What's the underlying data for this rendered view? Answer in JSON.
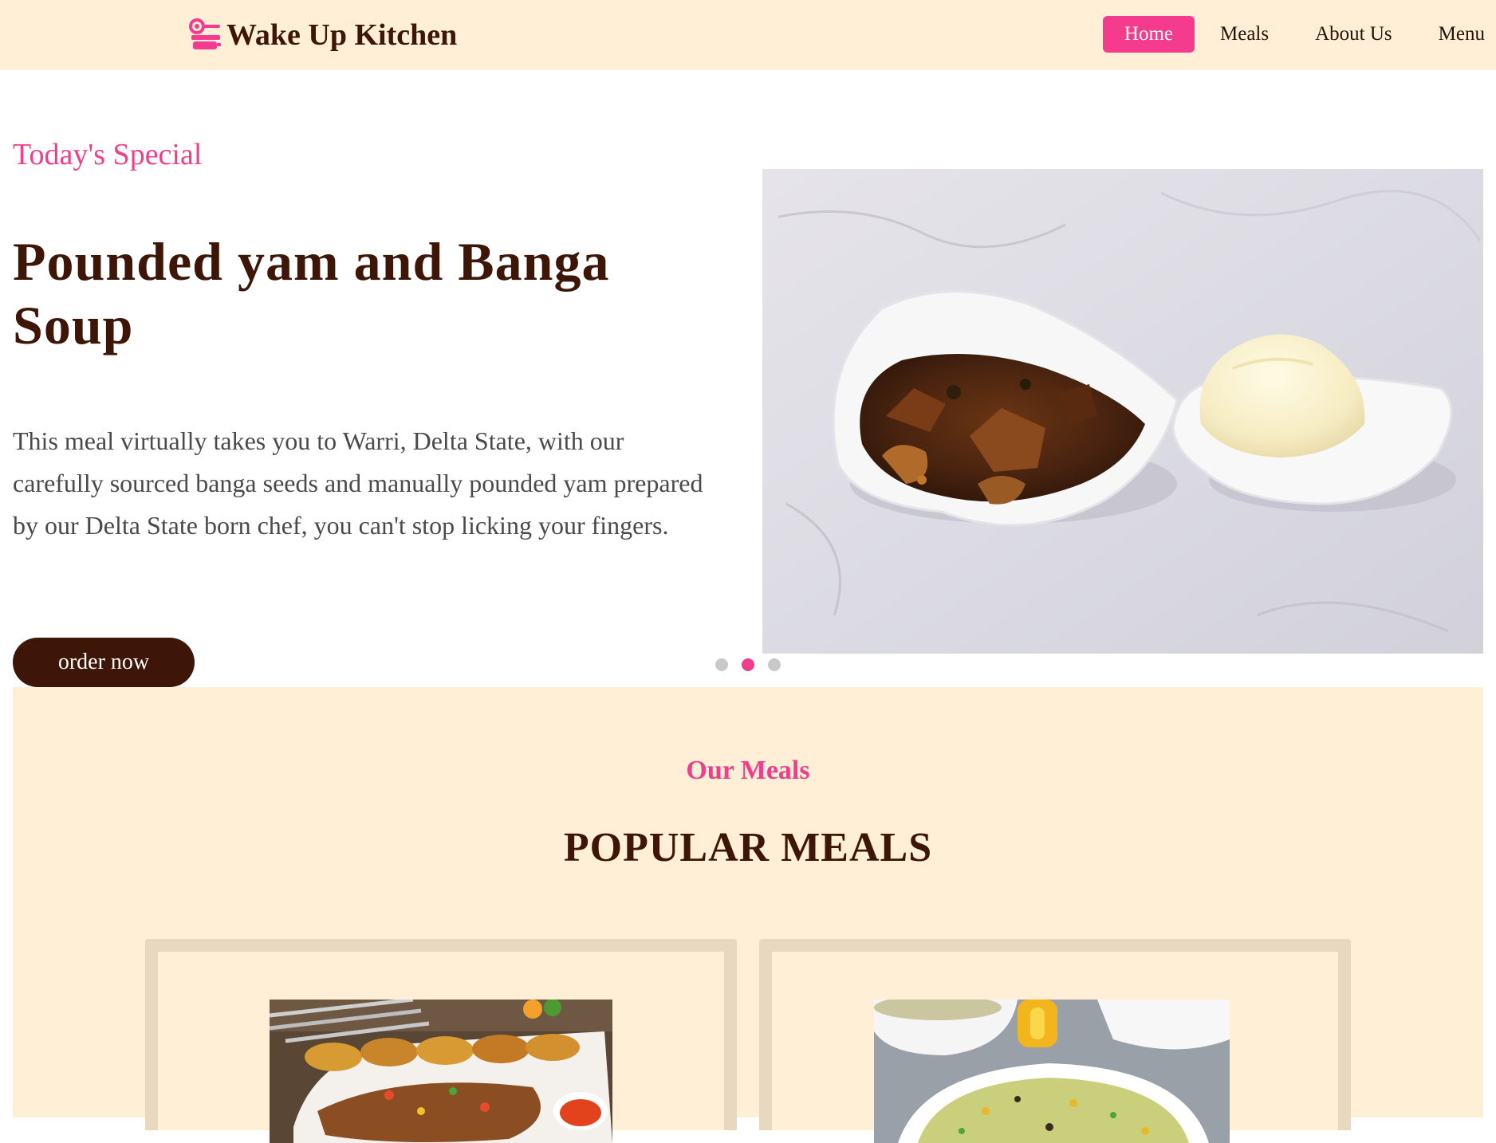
{
  "brand": {
    "name": "Wake Up Kitchen",
    "icon": "chef-kitchen-icon"
  },
  "nav": {
    "items": [
      {
        "label": "Home",
        "active": true
      },
      {
        "label": "Meals"
      },
      {
        "label": "About Us"
      },
      {
        "label": "Menu"
      }
    ]
  },
  "hero": {
    "eyebrow": "Today's Special",
    "title": "Pounded yam and Banga Soup",
    "description": "This meal virtually takes you to Warri, Delta State, with our carefully sourced banga seeds and manually pounded yam prepared by our Delta State born chef, you can't stop licking your fingers.",
    "cta_label": "order now",
    "image": "banga-soup-and-pounded-yam-photo",
    "carousel": {
      "slides": 3,
      "active_index": 1
    }
  },
  "meals_section": {
    "eyebrow": "Our Meals",
    "title": "POPULAR MEALS",
    "cards": [
      {
        "image": "grilled-fish-and-plantain-photo"
      },
      {
        "image": "fried-rice-photo"
      }
    ]
  },
  "colors": {
    "accent_pink": "#ef3e8b",
    "brand_brown": "#3d1607",
    "cream_bg": "#ffefd6",
    "card_border": "#e8d8c0"
  }
}
